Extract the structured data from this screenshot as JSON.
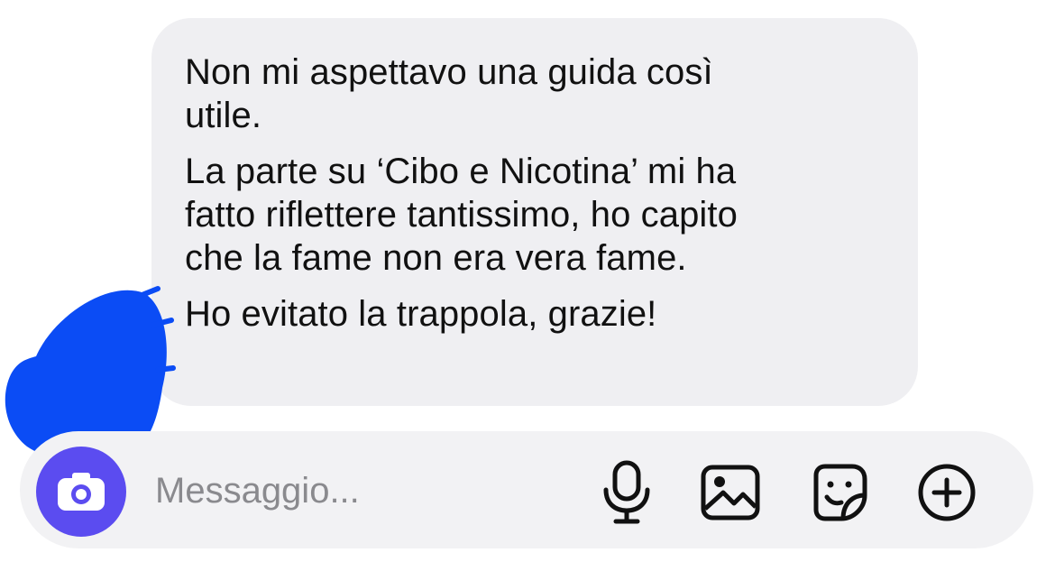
{
  "message": {
    "lines": [
      "Non mi aspettavo una guida così",
      "utile.",
      "La parte su ‘Cibo e Nicotina’ mi ha",
      "fatto riflettere tantissimo, ho capito",
      "che la fame non era vera fame.",
      "Ho evitato la trappola, grazie!"
    ]
  },
  "composer": {
    "placeholder": "Messaggio...",
    "icons": [
      "camera-icon",
      "microphone-icon",
      "image-icon",
      "sticker-icon",
      "plus-icon"
    ]
  },
  "colors": {
    "bubble": "#efeff2",
    "text": "#111111",
    "camera_button": "#5b4cf0",
    "scribble": "#0b4cf5",
    "placeholder": "#8a8a8e"
  }
}
